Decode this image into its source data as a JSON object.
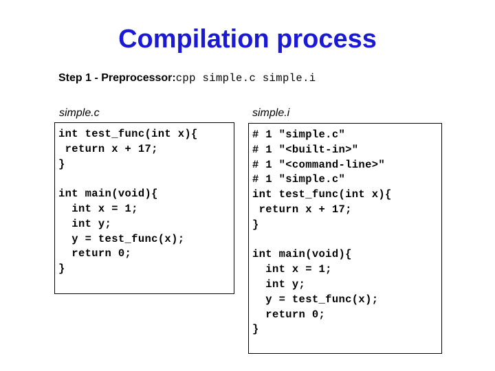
{
  "slide": {
    "title": "Compilation process",
    "title_color": "#1a1ad6",
    "background_color": "#ffffff"
  },
  "step": {
    "label": "Step 1 - Preprocessor:",
    "command": "cpp simple.c simple.i"
  },
  "panels": {
    "source": {
      "label": "simple.c",
      "lines": [
        "int test_func(int x){",
        " return x + 17;",
        "}",
        "",
        "int main(void){",
        "  int x = 1;",
        "  int y;",
        "  y = test_func(x);",
        "  return 0;",
        "}"
      ]
    },
    "output": {
      "label": "simple.i",
      "lines": [
        "# 1 \"simple.c\"",
        "# 1 \"<built-in>\"",
        "# 1 \"<command-line>\"",
        "# 1 \"simple.c\"",
        "int test_func(int x){",
        " return x + 17;",
        "}",
        "",
        "int main(void){",
        "  int x = 1;",
        "  int y;",
        "  y = test_func(x);",
        "  return 0;",
        "}"
      ]
    }
  }
}
